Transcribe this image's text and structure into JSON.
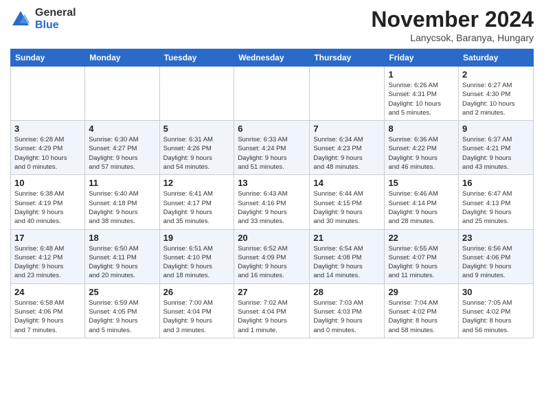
{
  "header": {
    "logo_general": "General",
    "logo_blue": "Blue",
    "title": "November 2024",
    "location": "Lanycsok, Baranya, Hungary"
  },
  "days_of_week": [
    "Sunday",
    "Monday",
    "Tuesday",
    "Wednesday",
    "Thursday",
    "Friday",
    "Saturday"
  ],
  "weeks": [
    [
      {
        "day": "",
        "info": ""
      },
      {
        "day": "",
        "info": ""
      },
      {
        "day": "",
        "info": ""
      },
      {
        "day": "",
        "info": ""
      },
      {
        "day": "",
        "info": ""
      },
      {
        "day": "1",
        "info": "Sunrise: 6:26 AM\nSunset: 4:31 PM\nDaylight: 10 hours\nand 5 minutes."
      },
      {
        "day": "2",
        "info": "Sunrise: 6:27 AM\nSunset: 4:30 PM\nDaylight: 10 hours\nand 2 minutes."
      }
    ],
    [
      {
        "day": "3",
        "info": "Sunrise: 6:28 AM\nSunset: 4:29 PM\nDaylight: 10 hours\nand 0 minutes."
      },
      {
        "day": "4",
        "info": "Sunrise: 6:30 AM\nSunset: 4:27 PM\nDaylight: 9 hours\nand 57 minutes."
      },
      {
        "day": "5",
        "info": "Sunrise: 6:31 AM\nSunset: 4:26 PM\nDaylight: 9 hours\nand 54 minutes."
      },
      {
        "day": "6",
        "info": "Sunrise: 6:33 AM\nSunset: 4:24 PM\nDaylight: 9 hours\nand 51 minutes."
      },
      {
        "day": "7",
        "info": "Sunrise: 6:34 AM\nSunset: 4:23 PM\nDaylight: 9 hours\nand 48 minutes."
      },
      {
        "day": "8",
        "info": "Sunrise: 6:36 AM\nSunset: 4:22 PM\nDaylight: 9 hours\nand 46 minutes."
      },
      {
        "day": "9",
        "info": "Sunrise: 6:37 AM\nSunset: 4:21 PM\nDaylight: 9 hours\nand 43 minutes."
      }
    ],
    [
      {
        "day": "10",
        "info": "Sunrise: 6:38 AM\nSunset: 4:19 PM\nDaylight: 9 hours\nand 40 minutes."
      },
      {
        "day": "11",
        "info": "Sunrise: 6:40 AM\nSunset: 4:18 PM\nDaylight: 9 hours\nand 38 minutes."
      },
      {
        "day": "12",
        "info": "Sunrise: 6:41 AM\nSunset: 4:17 PM\nDaylight: 9 hours\nand 35 minutes."
      },
      {
        "day": "13",
        "info": "Sunrise: 6:43 AM\nSunset: 4:16 PM\nDaylight: 9 hours\nand 33 minutes."
      },
      {
        "day": "14",
        "info": "Sunrise: 6:44 AM\nSunset: 4:15 PM\nDaylight: 9 hours\nand 30 minutes."
      },
      {
        "day": "15",
        "info": "Sunrise: 6:46 AM\nSunset: 4:14 PM\nDaylight: 9 hours\nand 28 minutes."
      },
      {
        "day": "16",
        "info": "Sunrise: 6:47 AM\nSunset: 4:13 PM\nDaylight: 9 hours\nand 25 minutes."
      }
    ],
    [
      {
        "day": "17",
        "info": "Sunrise: 6:48 AM\nSunset: 4:12 PM\nDaylight: 9 hours\nand 23 minutes."
      },
      {
        "day": "18",
        "info": "Sunrise: 6:50 AM\nSunset: 4:11 PM\nDaylight: 9 hours\nand 20 minutes."
      },
      {
        "day": "19",
        "info": "Sunrise: 6:51 AM\nSunset: 4:10 PM\nDaylight: 9 hours\nand 18 minutes."
      },
      {
        "day": "20",
        "info": "Sunrise: 6:52 AM\nSunset: 4:09 PM\nDaylight: 9 hours\nand 16 minutes."
      },
      {
        "day": "21",
        "info": "Sunrise: 6:54 AM\nSunset: 4:08 PM\nDaylight: 9 hours\nand 14 minutes."
      },
      {
        "day": "22",
        "info": "Sunrise: 6:55 AM\nSunset: 4:07 PM\nDaylight: 9 hours\nand 11 minutes."
      },
      {
        "day": "23",
        "info": "Sunrise: 6:56 AM\nSunset: 4:06 PM\nDaylight: 9 hours\nand 9 minutes."
      }
    ],
    [
      {
        "day": "24",
        "info": "Sunrise: 6:58 AM\nSunset: 4:06 PM\nDaylight: 9 hours\nand 7 minutes."
      },
      {
        "day": "25",
        "info": "Sunrise: 6:59 AM\nSunset: 4:05 PM\nDaylight: 9 hours\nand 5 minutes."
      },
      {
        "day": "26",
        "info": "Sunrise: 7:00 AM\nSunset: 4:04 PM\nDaylight: 9 hours\nand 3 minutes."
      },
      {
        "day": "27",
        "info": "Sunrise: 7:02 AM\nSunset: 4:04 PM\nDaylight: 9 hours\nand 1 minute."
      },
      {
        "day": "28",
        "info": "Sunrise: 7:03 AM\nSunset: 4:03 PM\nDaylight: 9 hours\nand 0 minutes."
      },
      {
        "day": "29",
        "info": "Sunrise: 7:04 AM\nSunset: 4:02 PM\nDaylight: 8 hours\nand 58 minutes."
      },
      {
        "day": "30",
        "info": "Sunrise: 7:05 AM\nSunset: 4:02 PM\nDaylight: 8 hours\nand 56 minutes."
      }
    ]
  ]
}
